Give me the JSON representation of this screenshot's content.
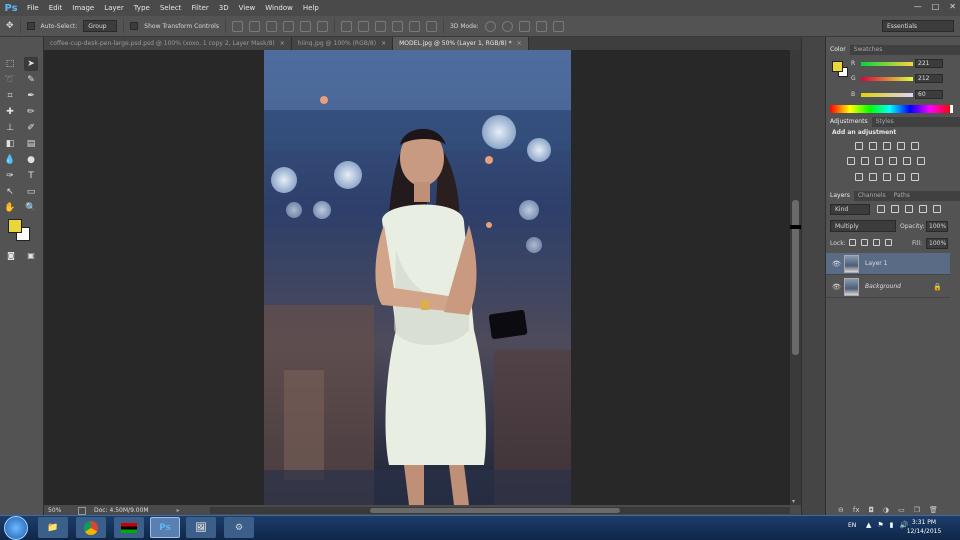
{
  "app": {
    "logo": "Ps"
  },
  "menu": [
    "File",
    "Edit",
    "Image",
    "Layer",
    "Type",
    "Select",
    "Filter",
    "3D",
    "View",
    "Window",
    "Help"
  ],
  "window_controls": [
    "—",
    "□",
    "✕"
  ],
  "options": {
    "auto_select_label": "Auto-Select:",
    "auto_select_value": "Group",
    "show_transform_label": "Show Transform Controls",
    "mode_3d_label": "3D Mode:",
    "workspace": "Essentials"
  },
  "tabs": [
    {
      "label": "coffee-cup-desk-pen-large.psd.psd @ 100% (xoxo, 1 copy 2, Layer Mask/8)",
      "active": false
    },
    {
      "label": "hiinq.jpg @ 100% (RGB/8)",
      "active": false
    },
    {
      "label": "MODEL.jpg @ 50% (Layer 1, RGB/8) *",
      "active": true
    }
  ],
  "status": {
    "zoom": "50%",
    "doc": "Doc: 4.50M/9.00M"
  },
  "color_panel": {
    "tabs": [
      "Color",
      "Swatches"
    ],
    "foreground": "#e8d63a",
    "r": "221",
    "g": "212",
    "b": "60",
    "r_label": "R",
    "g_label": "G",
    "b_label": "B"
  },
  "adjustments_panel": {
    "tabs": [
      "Adjustments",
      "Styles"
    ],
    "heading": "Add an adjustment"
  },
  "layers_panel": {
    "tabs": [
      "Layers",
      "Channels",
      "Paths"
    ],
    "kind": "Kind",
    "blend_mode": "Multiply",
    "opacity_label": "Opacity:",
    "opacity": "100%",
    "lock_label": "Lock:",
    "fill_label": "Fill:",
    "fill": "100%",
    "layers": [
      {
        "name": "Layer 1",
        "selected": true
      },
      {
        "name": "Background",
        "selected": false
      }
    ]
  },
  "taskbar": {
    "lang": "EN",
    "time": "3:31 PM",
    "date": "12/14/2015",
    "ps_label": "Ps"
  }
}
